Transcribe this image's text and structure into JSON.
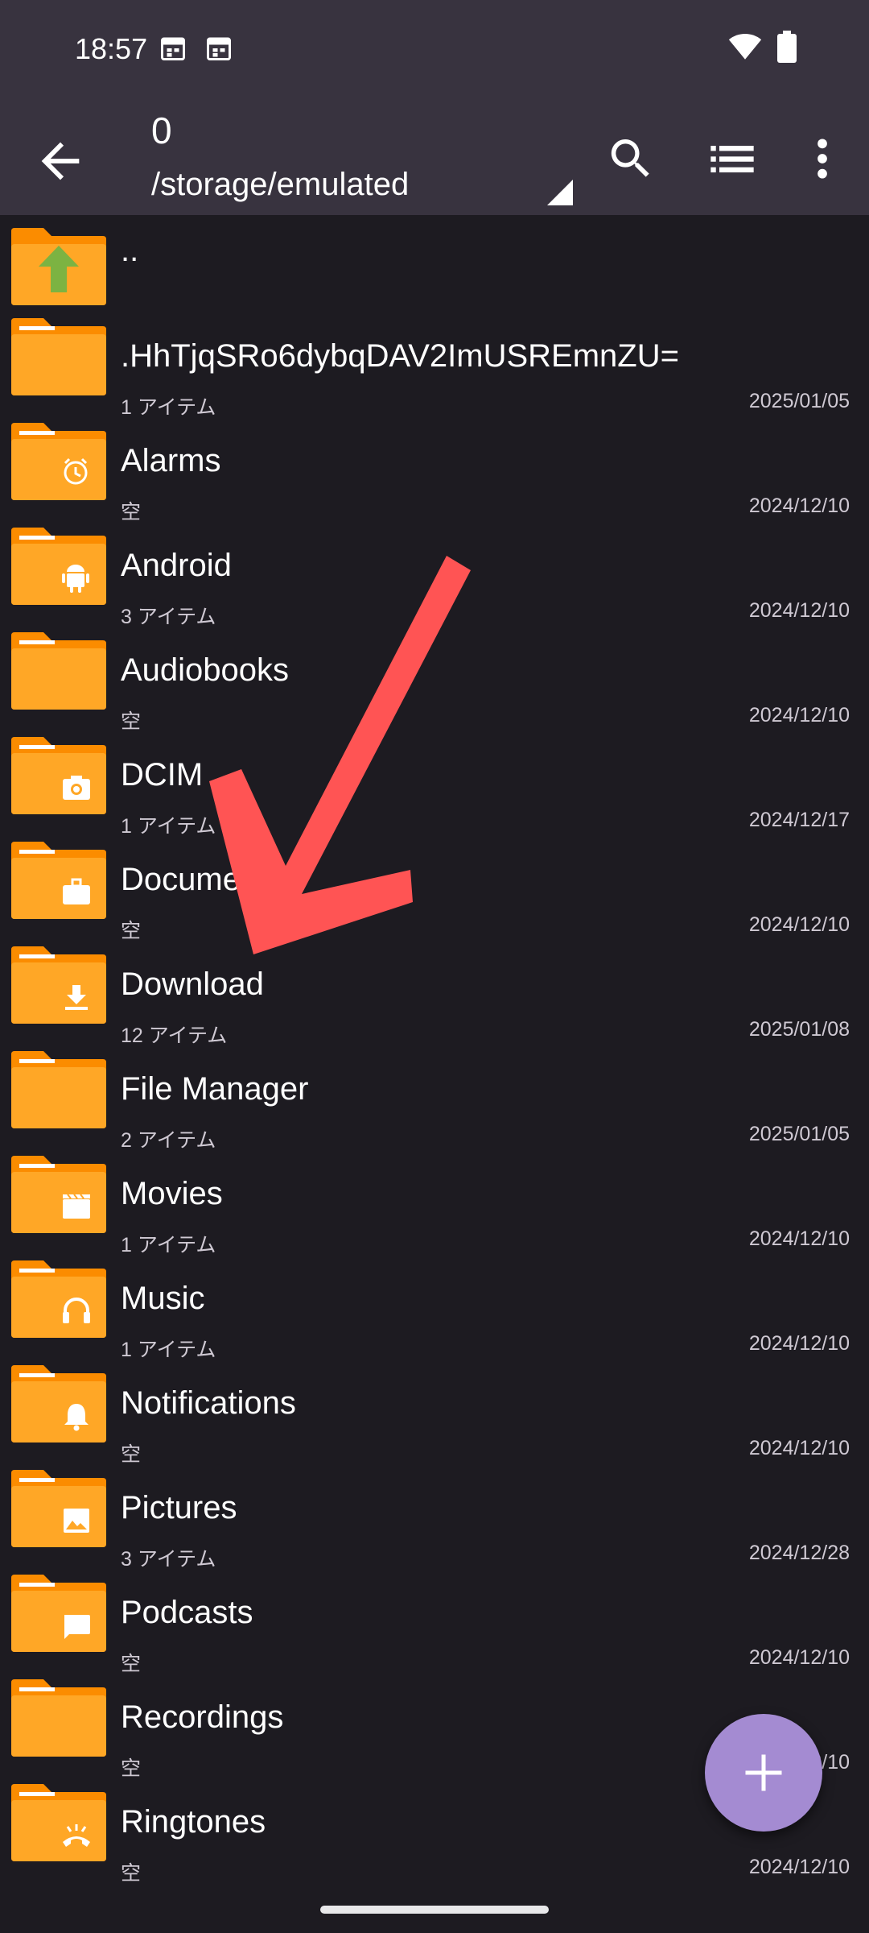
{
  "status_bar": {
    "time": "18:57",
    "icons": [
      "calendar-icon",
      "calendar-icon",
      "wifi-icon",
      "battery-icon"
    ]
  },
  "app_bar": {
    "title": "0",
    "path": "/storage/emulated",
    "actions": [
      "search-icon",
      "list-view-icon",
      "more-vert-icon"
    ]
  },
  "colors": {
    "background": "#1d1b21",
    "bars": "#38333f",
    "folder": "#ffa726",
    "folder_tab": "#fb8c00",
    "fab": "#a48bd2",
    "annotation_arrow": "#ff5252"
  },
  "files": [
    {
      "name": "..",
      "meta": "",
      "date": "",
      "icon": "folder-up"
    },
    {
      "name": ".HhTjqSRo6dybqDAV2ImUSREmnZU=",
      "meta": "1 アイテム",
      "date": "2025/01/05",
      "icon": "folder"
    },
    {
      "name": "Alarms",
      "meta": "空",
      "date": "2024/12/10",
      "icon": "alarm"
    },
    {
      "name": "Android",
      "meta": "3 アイテム",
      "date": "2024/12/10",
      "icon": "android"
    },
    {
      "name": "Audiobooks",
      "meta": "空",
      "date": "2024/12/10",
      "icon": "folder"
    },
    {
      "name": "DCIM",
      "meta": "1 アイテム",
      "date": "2024/12/17",
      "icon": "camera"
    },
    {
      "name": "Documents",
      "meta": "空",
      "date": "2024/12/10",
      "icon": "briefcase"
    },
    {
      "name": "Download",
      "meta": "12 アイテム",
      "date": "2025/01/08",
      "icon": "download"
    },
    {
      "name": "File Manager",
      "meta": "2 アイテム",
      "date": "2025/01/05",
      "icon": "folder"
    },
    {
      "name": "Movies",
      "meta": "1 アイテム",
      "date": "2024/12/10",
      "icon": "movie"
    },
    {
      "name": "Music",
      "meta": "1 アイテム",
      "date": "2024/12/10",
      "icon": "headphones"
    },
    {
      "name": "Notifications",
      "meta": "空",
      "date": "2024/12/10",
      "icon": "bell"
    },
    {
      "name": "Pictures",
      "meta": "3 アイテム",
      "date": "2024/12/28",
      "icon": "image"
    },
    {
      "name": "Podcasts",
      "meta": "空",
      "date": "2024/12/10",
      "icon": "chat"
    },
    {
      "name": "Recordings",
      "meta": "空",
      "date": "2024/12/10",
      "icon": "folder"
    },
    {
      "name": "Ringtones",
      "meta": "空",
      "date": "2024/12/10",
      "icon": "ringtone"
    }
  ],
  "fab": {
    "icon": "plus-icon"
  }
}
